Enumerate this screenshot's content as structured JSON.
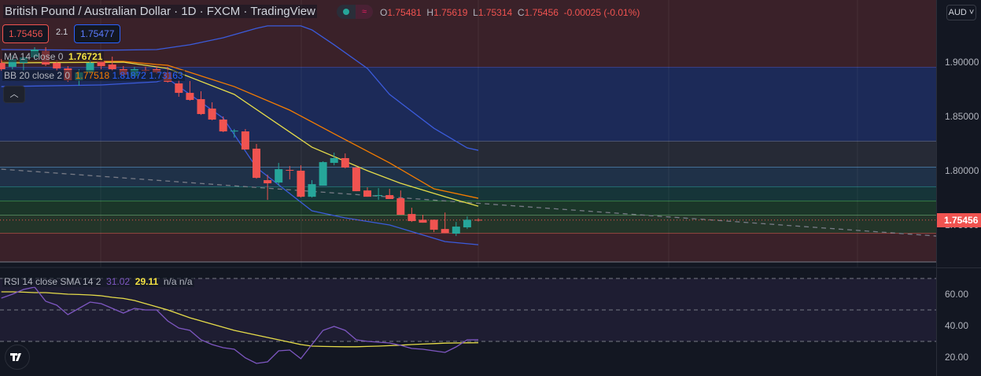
{
  "header": {
    "title": "British Pound / Australian Dollar · 1D · FXCM · TradingView",
    "ohlc": {
      "o_label": "O",
      "o": "1.75481",
      "h_label": "H",
      "h": "1.75619",
      "l_label": "L",
      "l": "1.75314",
      "c_label": "C",
      "c": "1.75456",
      "change": "-0.00025 (-0.01%)"
    },
    "status_icon": "market-wave-icon",
    "bid": "1.75456",
    "spread": "2.1",
    "ask": "1.75477"
  },
  "indicators": {
    "ma": {
      "label": "MA 14 close 0",
      "value": "1.76721"
    },
    "bb": {
      "label": "BB 20 close 2 0",
      "basis": "1.77518",
      "upper": "1.81872",
      "lower": "1.73163"
    },
    "rsi": {
      "label": "RSI 14 close SMA 14 2",
      "rsi": "31.02",
      "sma": "29.11",
      "na1": "n/a",
      "na2": "n/a"
    }
  },
  "axis": {
    "currency": "AUD",
    "price_ticks": [
      "1.90000",
      "1.85000",
      "1.80000",
      "1.75000"
    ],
    "current_price": "1.75456",
    "rsi_ticks": [
      "60.00",
      "40.00",
      "20.00"
    ]
  },
  "colors": {
    "up": "#26a69a",
    "down": "#f05350",
    "bb_band": "#3b5bdb",
    "bb_basis": "#f57c00",
    "ma": "#e6dc4a",
    "rsi": "#7e57c2",
    "rsi_sma": "#e6dc4a"
  },
  "chart_data": {
    "type": "candlestick",
    "symbol": "GBPAUD",
    "interval": "1D",
    "ylim": [
      1.7,
      1.94
    ],
    "price_ticks": [
      1.9,
      1.85,
      1.8,
      1.75
    ],
    "start_index": -1,
    "ohlc": [
      [
        1.8993,
        1.9029,
        1.892,
        1.8935
      ],
      [
        1.8957,
        1.9065,
        1.8935,
        1.9029
      ],
      [
        1.8993,
        1.9051,
        1.892,
        1.9044
      ],
      [
        1.9044,
        1.9138,
        1.9022,
        1.9116
      ],
      [
        1.9102,
        1.9138,
        1.8964,
        1.8978
      ],
      [
        1.8993,
        1.9022,
        1.892,
        1.8942
      ],
      [
        1.8942,
        1.8964,
        1.8819,
        1.8833
      ],
      [
        1.8833,
        1.8935,
        1.8783,
        1.8906
      ],
      [
        1.8906,
        1.9022,
        1.8891,
        1.8993
      ],
      [
        1.9007,
        1.9051,
        1.8935,
        1.8964
      ],
      [
        1.8978,
        1.9051,
        1.892,
        1.8935
      ],
      [
        1.8935,
        1.8964,
        1.8862,
        1.8884
      ],
      [
        1.887,
        1.8957,
        1.8848,
        1.8935
      ],
      [
        1.8928,
        1.8957,
        1.8899,
        1.892
      ],
      [
        1.8935,
        1.8964,
        1.8891,
        1.8906
      ],
      [
        1.8906,
        1.8957,
        1.8812,
        1.8819
      ],
      [
        1.8804,
        1.8833,
        1.8681,
        1.8717
      ],
      [
        1.8717,
        1.8826,
        1.8645,
        1.8652
      ],
      [
        1.8659,
        1.8732,
        1.8514,
        1.8522
      ],
      [
        1.8572,
        1.863,
        1.8464,
        1.8471
      ],
      [
        1.8471,
        1.85,
        1.8355,
        1.8362
      ],
      [
        1.8362,
        1.8384,
        1.8304,
        1.8369
      ],
      [
        1.8362,
        1.8384,
        1.8195,
        1.8195
      ],
      [
        1.8203,
        1.8246,
        1.7927,
        1.7934
      ],
      [
        1.7913,
        1.7963,
        1.7731,
        1.7884
      ],
      [
        1.7891,
        1.8072,
        1.7862,
        1.8014
      ],
      [
        1.8007,
        1.8043,
        1.792,
        1.8
      ],
      [
        1.8,
        1.805,
        1.7753,
        1.776
      ],
      [
        1.776,
        1.7913,
        1.7753,
        1.7876
      ],
      [
        1.7862,
        1.8087,
        1.7862,
        1.8079
      ],
      [
        1.8072,
        1.8166,
        1.805,
        1.8116
      ],
      [
        1.8116,
        1.8159,
        1.8021,
        1.8029
      ],
      [
        1.8029,
        1.8043,
        1.7811,
        1.7811
      ],
      [
        1.7818,
        1.7847,
        1.776,
        1.776
      ],
      [
        1.7768,
        1.784,
        1.7731,
        1.7775
      ],
      [
        1.7775,
        1.7833,
        1.7739,
        1.7739
      ],
      [
        1.7746,
        1.7818,
        1.7594,
        1.7594
      ],
      [
        1.7601,
        1.7659,
        1.7528,
        1.7536
      ],
      [
        1.7548,
        1.7594,
        1.7521,
        1.7521
      ],
      [
        1.7548,
        1.755,
        1.7434,
        1.7456
      ],
      [
        1.7463,
        1.7615,
        1.7427,
        1.7427
      ],
      [
        1.742,
        1.7528,
        1.7398,
        1.7485
      ],
      [
        1.7478,
        1.758,
        1.7463,
        1.7548
      ],
      [
        1.75481,
        1.75619,
        1.75314,
        1.75456
      ]
    ],
    "bb_upper": [
      [
        -1,
        1.9116
      ],
      [
        8,
        1.9109
      ],
      [
        13,
        1.9116
      ],
      [
        16,
        1.916
      ],
      [
        19,
        1.9225
      ],
      [
        22,
        1.9312
      ],
      [
        23,
        1.9334
      ],
      [
        26,
        1.9334
      ],
      [
        27,
        1.9297
      ],
      [
        29,
        1.916
      ],
      [
        32,
        1.8942
      ],
      [
        34,
        1.8703
      ],
      [
        38,
        1.8391
      ],
      [
        41,
        1.821
      ],
      [
        42,
        1.8188
      ]
    ],
    "bb_basis": [
      [
        -1,
        1.9007
      ],
      [
        10,
        1.9007
      ],
      [
        13,
        1.8978
      ],
      [
        14,
        1.8971
      ],
      [
        20,
        1.8775
      ],
      [
        25,
        1.8558
      ],
      [
        29,
        1.834
      ],
      [
        34,
        1.8072
      ],
      [
        38,
        1.7833
      ],
      [
        42,
        1.7746
      ]
    ],
    "bb_lower": [
      [
        -1,
        1.8775
      ],
      [
        8,
        1.879
      ],
      [
        13,
        1.8819
      ],
      [
        14,
        1.8848
      ],
      [
        19,
        1.8485
      ],
      [
        22,
        1.8029
      ],
      [
        26,
        1.771
      ],
      [
        27,
        1.763
      ],
      [
        30,
        1.7565
      ],
      [
        34,
        1.75
      ],
      [
        39,
        1.7347
      ],
      [
        42,
        1.7318
      ]
    ],
    "ma14": [
      [
        -1,
        1.8993
      ],
      [
        10,
        1.9
      ],
      [
        14,
        1.8942
      ],
      [
        20,
        1.8703
      ],
      [
        27,
        1.8217
      ],
      [
        32,
        1.8
      ],
      [
        35,
        1.7884
      ],
      [
        39,
        1.776
      ],
      [
        42,
        1.7673
      ]
    ],
    "trend_line": [
      [
        -1,
        1.8014
      ],
      [
        83.3,
        1.7398
      ]
    ],
    "fib_levels": [
      {
        "price": 1.8949,
        "color": "#3b5bdb",
        "fill_above": "#3a2129"
      },
      {
        "price": 1.8268,
        "color": "#787b86",
        "fill_above": "#1c2a58"
      },
      {
        "price": 1.8029,
        "color": "#64b5f6",
        "fill_above": "#262a36"
      },
      {
        "price": 1.7848,
        "color": "#26a69a",
        "fill_above": "#1f3148"
      },
      {
        "price": 1.7717,
        "color": "#4caf50",
        "fill_above": "#163539"
      },
      {
        "price": 1.7587,
        "color": "#81c784",
        "fill_above": "#1b3629"
      },
      {
        "price": 1.742,
        "color": "#f05350",
        "fill_above": "#243529"
      },
      {
        "price": 1.7159,
        "color": "#787b86",
        "fill_above": "#3a2129"
      }
    ],
    "rsi": {
      "ylim": [
        0,
        80
      ],
      "levels": [
        70,
        50,
        30
      ],
      "ticks": [
        60,
        40,
        20
      ],
      "values": [
        57.5,
        60,
        63,
        64.5,
        55.5,
        53,
        47,
        51,
        55,
        54,
        51,
        48,
        51,
        50,
        50,
        43,
        38.5,
        37,
        31,
        28,
        26,
        25,
        19.5,
        16,
        17,
        24,
        24.5,
        19,
        28,
        37,
        39.5,
        37,
        31,
        30,
        29.5,
        29,
        27.5,
        25.5,
        25,
        24,
        23,
        26.5,
        31,
        31.02
      ],
      "sma": [
        61.5,
        61.5,
        61.3,
        61,
        61,
        60.5,
        60,
        59.8,
        59.5,
        59,
        58,
        57.3,
        56,
        54,
        52,
        50,
        47.5,
        45,
        43,
        41,
        39,
        37,
        35.5,
        34,
        32.5,
        31,
        29.5,
        28,
        27,
        26.8,
        26.7,
        26.6,
        26.6,
        26.8,
        27,
        27.3,
        27.6,
        28,
        28.3,
        28.6,
        28.9,
        29,
        29.1,
        29.11
      ]
    }
  }
}
